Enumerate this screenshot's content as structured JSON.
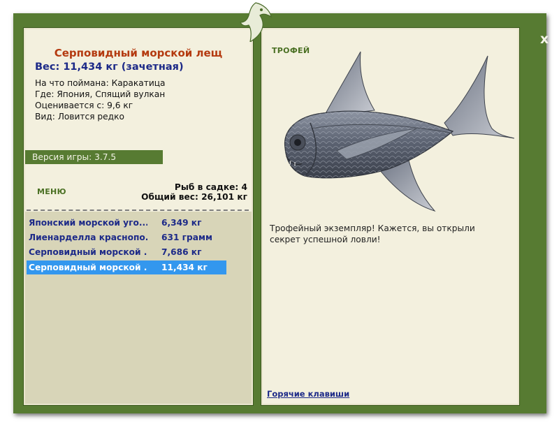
{
  "window": {
    "close_label": "x"
  },
  "fish": {
    "name": "Серповидный морской лещ",
    "weight_line": "Вес: 11,434 кг (зачетная)",
    "info": [
      "На что поймана: Каракатица",
      "Где: Япония, Спящий вулкан",
      "Оценивается с: 9,6 кг",
      "Вид: Ловится редко"
    ]
  },
  "version_label": "Версия игры: 3.7.5",
  "menu_label": "МЕНЮ",
  "keepnet": {
    "count": "Рыб в садке: 4",
    "total": "Общий вес: 26,101 кг"
  },
  "catch_list": [
    {
      "name": "Японский морской угорь",
      "weight": "6,349 кг",
      "selected": false
    },
    {
      "name": "Лиенарделла краснополосая",
      "weight": "631 грамм",
      "selected": false
    },
    {
      "name": "Серповидный морской лещ",
      "weight": "7,686 кг",
      "selected": false
    },
    {
      "name": "Серповидный морской лещ",
      "weight": "11,434 кг",
      "selected": true
    }
  ],
  "catch_list_display": [
    "Японский морской уго...",
    "Лиенарделла краснопо...",
    "Серповидный морской ...",
    "Серповидный морской ..."
  ],
  "trophy_label": "ТРОФЕЙ",
  "description": "Трофейный экземпляр! Кажется, вы открыли секрет успешной ловли!",
  "hotkeys_label": "Горячие клавиши",
  "colors": {
    "frame_green": "#577b32",
    "panel_cream": "#f3f0de",
    "list_bg": "#d8d5b8",
    "selected_row": "#3397ee",
    "title_red": "#b43a10",
    "text_navy": "#1d2a88"
  },
  "icons": {
    "logo": "green-fish-logo-icon",
    "close": "close-icon",
    "fish_picture": "fish-photo"
  }
}
